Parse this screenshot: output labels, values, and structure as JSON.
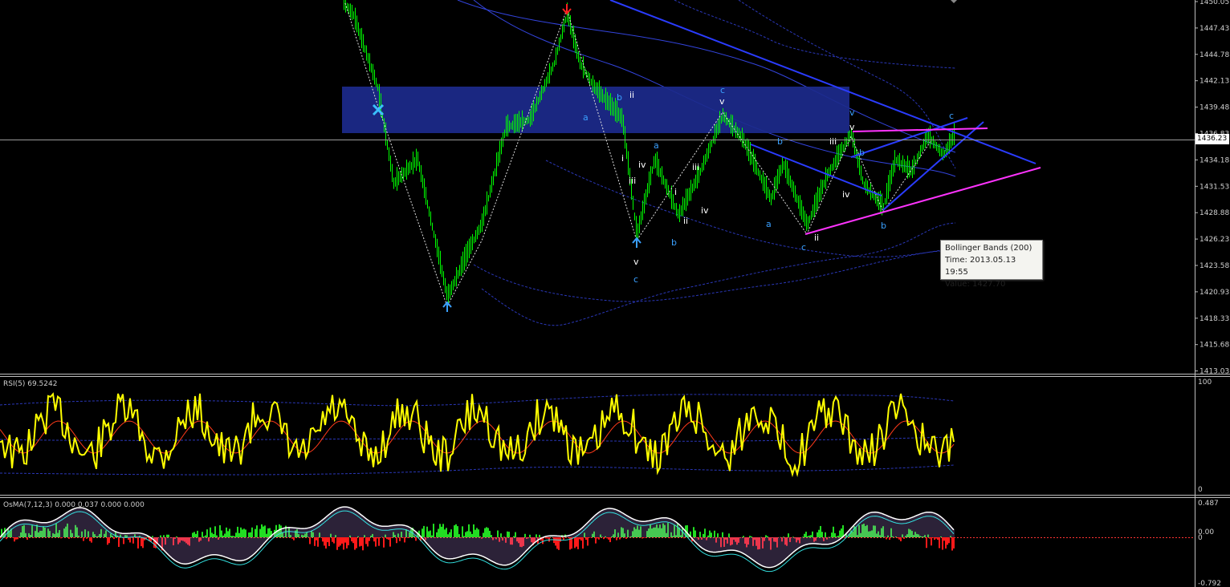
{
  "main_panel": {
    "price_ticks": [
      "1450.05",
      "1447.43",
      "1444.78",
      "1442.13",
      "1439.48",
      "1436.83",
      "1434.18",
      "1431.53",
      "1428.88",
      "1426.23",
      "1423.58",
      "1420.93",
      "1418.33",
      "1415.68",
      "1413.03"
    ],
    "current_price": "1436.23",
    "current_price_value": 1436.23,
    "price_range": [
      1413.03,
      1450.05
    ],
    "wave_labels": [
      "a",
      "b",
      "ii",
      "i",
      "iv",
      "iii",
      "v",
      "c",
      "v",
      "c",
      "a",
      "i",
      "ii",
      "iii",
      "iv",
      "b",
      "c",
      "v",
      "b",
      "a",
      "iii",
      "v",
      "a",
      "iv",
      "ii",
      "c",
      "b",
      "b",
      "c"
    ]
  },
  "tooltip": {
    "name": "Bollinger Bands (200)",
    "time": "Time: 2013.05.13 19:55",
    "value": "Value: 1427.70"
  },
  "rsi_panel": {
    "label": "RSI(5) 69.5242",
    "scale_max": "100",
    "scale_min": "0"
  },
  "osma_panel": {
    "label": "OsMA(7,12,3) 0.000 0.037 0.000 0.000",
    "ticks": [
      "0.487",
      "0.00",
      "0",
      "-0.792"
    ]
  },
  "colors": {
    "background": "#000000",
    "candle": "#00ff00",
    "zone": "#1c2a8c",
    "trendline": "#2a3cff",
    "support": "#ff33ff",
    "rsi": "#ffff00",
    "osma_pos": "#22dd22",
    "osma_neg": "#ff1a1a",
    "wave_blue": "#3aa0ff"
  },
  "icons": [
    "arrow-down-icon",
    "arrow-up-icon",
    "cross-icon"
  ]
}
